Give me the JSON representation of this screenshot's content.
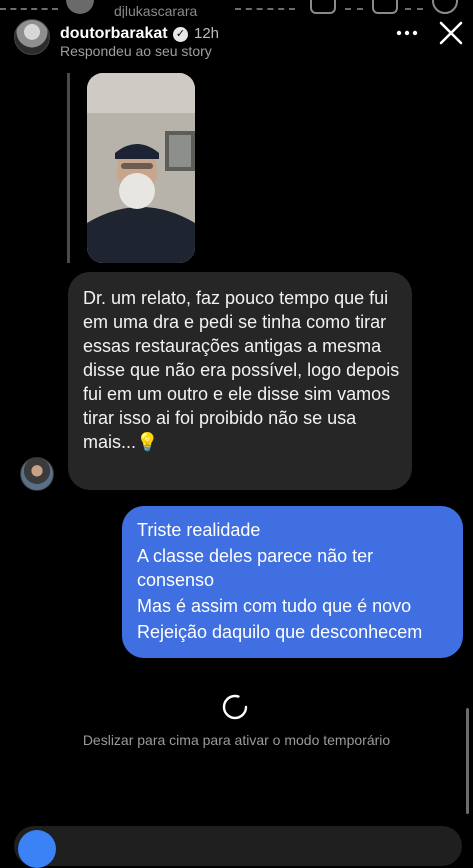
{
  "top_ghost": {
    "username": "djlukascarara"
  },
  "header": {
    "username": "doutorbarakat",
    "verified_glyph": "✓",
    "time_ago": "12h",
    "subtitle": "Respondeu ao seu story",
    "more_icon": "more-horizontal-icon",
    "close_icon": "close-icon"
  },
  "messages": {
    "incoming": {
      "text": "Dr. um relato, faz pouco tempo que fui em uma dra e pedi se tinha como tirar essas restaurações antigas a mesma disse que não era possível, logo depois fui em um outro e ele disse sim vamos tirar isso ai foi proibido não se usa mais...💡"
    },
    "outgoing": {
      "lines": [
        "Triste realidade",
        "A classe deles parece não ter",
        "consenso",
        "Mas é assim com tudo que é novo",
        "Rejeição daquilo que desconhecem"
      ]
    }
  },
  "footer": {
    "hint": "Deslizar para cima para ativar o modo temporário"
  },
  "colors": {
    "background": "#000000",
    "incoming_bubble": "#262626",
    "outgoing_bubble": "#3f6fe0",
    "muted_text": "#9a9a9a"
  }
}
